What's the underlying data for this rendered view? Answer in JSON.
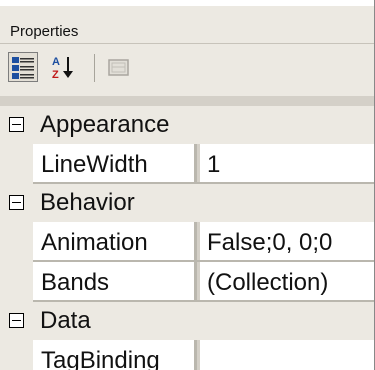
{
  "panel": {
    "title": "Properties"
  },
  "toolbar": {
    "buttons": [
      {
        "icon": "categorized-icon",
        "pressed": true
      },
      {
        "icon": "alphabetical-icon",
        "pressed": false
      },
      {
        "icon": "property-pages-icon",
        "pressed": false,
        "disabled": true
      }
    ]
  },
  "categories": [
    {
      "label": "Appearance",
      "properties": [
        {
          "name": "LineWidth",
          "value": "1"
        }
      ]
    },
    {
      "label": "Behavior",
      "properties": [
        {
          "name": "Animation",
          "value": "False;0, 0;0"
        },
        {
          "name": "Bands",
          "value": "(Collection)"
        }
      ]
    },
    {
      "label": "Data",
      "properties": [
        {
          "name": "TagBinding",
          "value": ""
        }
      ]
    }
  ]
}
